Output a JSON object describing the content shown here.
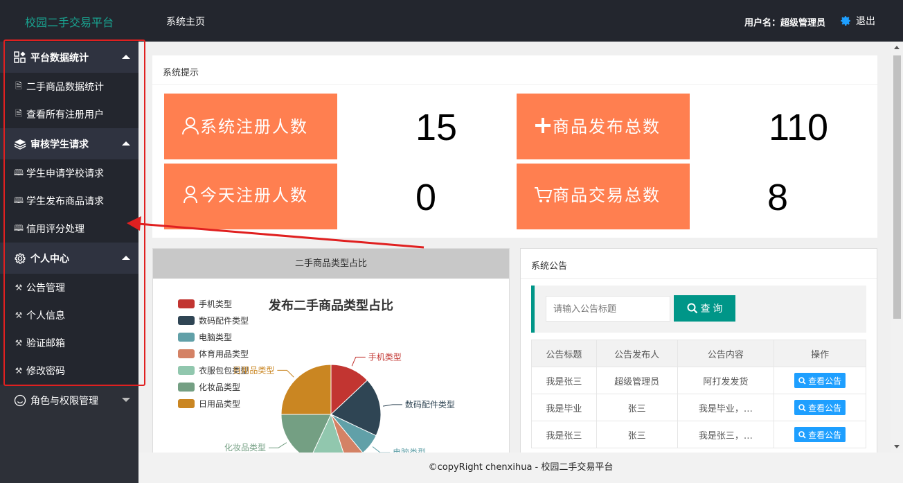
{
  "header": {
    "brand": "校园二手交易平台",
    "home_link": "系统主页",
    "user_label": "用户名：超级管理员",
    "logout_label": "退出"
  },
  "sidebar": {
    "groups": [
      {
        "label": "平台数据统计",
        "icon": "grid-icon",
        "items": [
          "二手商品数据统计",
          "查看所有注册用户"
        ]
      },
      {
        "label": "审核学生请求",
        "icon": "layers-icon",
        "items": [
          "学生申请学校请求",
          "学生发布商品请求",
          "信用评分处理"
        ]
      },
      {
        "label": "个人中心",
        "icon": "gear-icon",
        "items": [
          "公告管理",
          "个人信息",
          "验证邮箱",
          "修改密码"
        ]
      },
      {
        "label": "角色与权限管理",
        "icon": "smile-icon",
        "items": []
      }
    ]
  },
  "notice": {
    "title": "系统提示",
    "stats": [
      {
        "label": "系统注册人数",
        "value": "15",
        "icon": "users-icon"
      },
      {
        "label": "商品发布总数",
        "value": "110",
        "icon": "plus-icon"
      },
      {
        "label": "今天注册人数",
        "value": "0",
        "icon": "user-icon"
      },
      {
        "label": "商品交易总数",
        "value": "8",
        "icon": "cart-icon"
      }
    ]
  },
  "chart_card": {
    "header": "二手商品类型占比"
  },
  "chart_data": {
    "type": "pie",
    "title": "发布二手商品类型占比",
    "legend_position": "left",
    "categories": [
      "手机类型",
      "数码配件类型",
      "电脑类型",
      "体育用品类型",
      "衣服包包类型",
      "化妆品类型",
      "日用品类型"
    ],
    "values": [
      13,
      19,
      7,
      6,
      12,
      18,
      25
    ],
    "colors": [
      "#c23531",
      "#2f4554",
      "#61a0a8",
      "#d48265",
      "#91c7ae",
      "#749f83",
      "#ca8622"
    ]
  },
  "announcements": {
    "title": "系统公告",
    "search_placeholder": "请输入公告标题",
    "search_button": "查 询",
    "columns": [
      "公告标题",
      "公告发布人",
      "公告内容",
      "操作"
    ],
    "rows": [
      {
        "title": "我是张三",
        "publisher": "超级管理员",
        "content": "阿打发发货",
        "action": "查看公告"
      },
      {
        "title": "我是毕业",
        "publisher": "张三",
        "content": "我是毕业，…",
        "action": "查看公告"
      },
      {
        "title": "我是张三",
        "publisher": "张三",
        "content": "我是张三，…",
        "action": "查看公告"
      }
    ]
  },
  "footer": {
    "text": "©copyRight chenxihua - 校园二手交易平台"
  },
  "colors": {
    "accent": "#009688",
    "stat_tile": "#ff7f50",
    "annotation_red": "#e02020"
  }
}
